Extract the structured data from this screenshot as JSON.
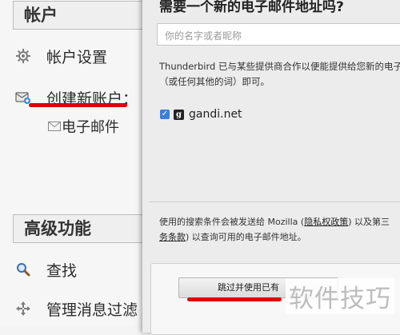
{
  "left_panel": {
    "accounts_header": "帐户",
    "account_settings": "帐户设置",
    "create_account": "创建新账户：",
    "email": "电子邮件",
    "advanced_header": "高级功能",
    "search": "查找",
    "manage_filters": "管理消息过滤"
  },
  "dialog": {
    "title": "需要一个新的电子邮件地址吗?",
    "name_placeholder": "你的名字或者昵称",
    "provider_description": "Thunderbird 已与某些提供商合作以便能提供给您新的电子（或任何其他的词）即可。",
    "providers": [
      {
        "name": "gandi.net",
        "checked": true
      }
    ],
    "footer_text_1": "使用的搜索条件会被发送给 Mozilla (",
    "footer_link_privacy": "隐私权政策",
    "footer_text_2": ") 以及第三",
    "footer_link_terms": "务条款",
    "footer_text_3": ") 以查询可用的电子邮件地址。",
    "skip_button": "跳过并使用已有"
  },
  "watermark": "软件技巧",
  "colors": {
    "annotation_red": "#e00000",
    "checkbox_blue": "#3d7fd6"
  }
}
